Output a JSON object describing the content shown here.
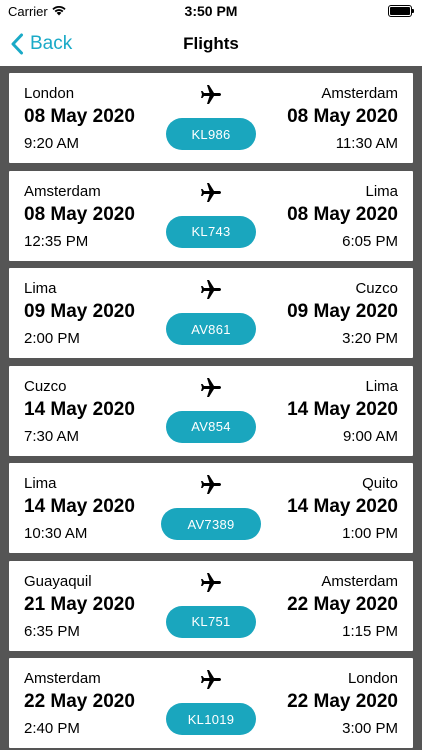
{
  "status_bar": {
    "carrier": "Carrier",
    "time": "3:50 PM"
  },
  "nav": {
    "back_label": "Back",
    "title": "Flights"
  },
  "flights": [
    {
      "origin": "London",
      "origin_date": "08 May 2020",
      "origin_time": "9:20 AM",
      "destination": "Amsterdam",
      "dest_date": "08 May 2020",
      "dest_time": "11:30 AM",
      "code": "KL986"
    },
    {
      "origin": "Amsterdam",
      "origin_date": "08 May 2020",
      "origin_time": "12:35 PM",
      "destination": "Lima",
      "dest_date": "08 May 2020",
      "dest_time": "6:05 PM",
      "code": "KL743"
    },
    {
      "origin": "Lima",
      "origin_date": "09 May 2020",
      "origin_time": "2:00 PM",
      "destination": "Cuzco",
      "dest_date": "09 May 2020",
      "dest_time": "3:20 PM",
      "code": "AV861"
    },
    {
      "origin": "Cuzco",
      "origin_date": "14 May 2020",
      "origin_time": "7:30 AM",
      "destination": "Lima",
      "dest_date": "14 May 2020",
      "dest_time": "9:00 AM",
      "code": "AV854"
    },
    {
      "origin": "Lima",
      "origin_date": "14 May 2020",
      "origin_time": "10:30 AM",
      "destination": "Quito",
      "dest_date": "14 May 2020",
      "dest_time": "1:00 PM",
      "code": "AV7389"
    },
    {
      "origin": "Guayaquil",
      "origin_date": "21 May 2020",
      "origin_time": "6:35 PM",
      "destination": "Amsterdam",
      "dest_date": "22 May 2020",
      "dest_time": "1:15 PM",
      "code": "KL751"
    },
    {
      "origin": "Amsterdam",
      "origin_date": "22 May 2020",
      "origin_time": "2:40 PM",
      "destination": "London",
      "dest_date": "22 May 2020",
      "dest_time": "3:00 PM",
      "code": "KL1019"
    }
  ],
  "colors": {
    "accent": "#1aaac7",
    "badge": "#1aa6be",
    "list_background": "#555555"
  },
  "icons": {
    "back": "chevron-left-icon",
    "plane": "airplane-icon",
    "wifi": "wifi-icon",
    "battery": "battery-icon"
  }
}
